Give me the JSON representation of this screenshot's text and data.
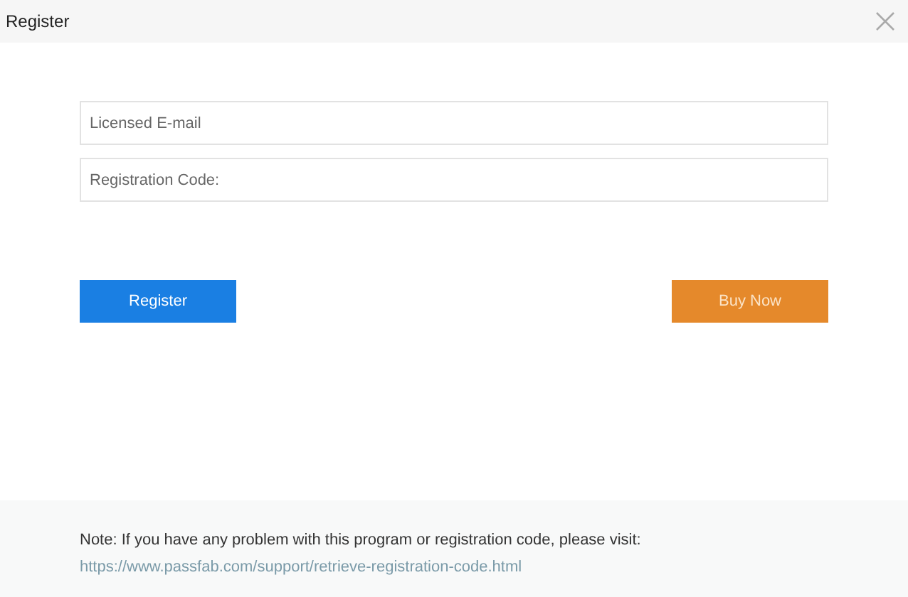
{
  "window": {
    "title": "Register"
  },
  "fields": [
    {
      "placeholder": "Licensed E-mail"
    },
    {
      "placeholder": "Registration Code:"
    }
  ],
  "buttons": [
    {
      "kind": "primary",
      "label": "Register"
    },
    {
      "kind": "buy",
      "label": "Buy Now"
    }
  ],
  "note": {
    "text": "Note: If you have any problem with this program or registration code, please visit:",
    "link": "https://www.passfab.com/support/retrieve-registration-code.html"
  }
}
